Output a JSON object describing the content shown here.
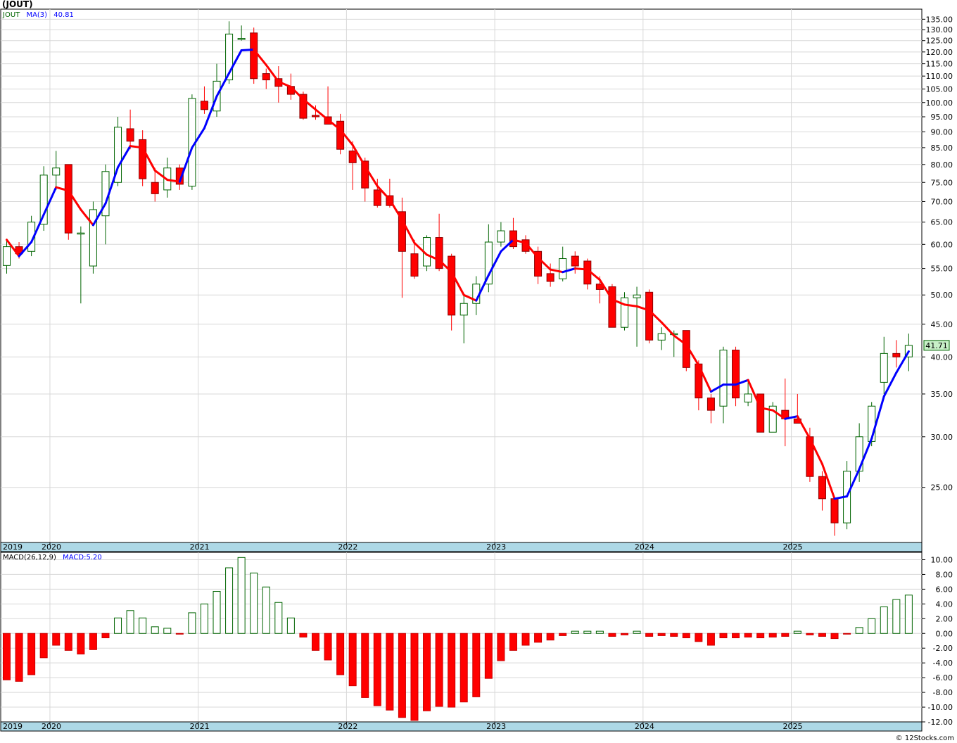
{
  "title": "(JOUT)",
  "legend": {
    "ticker": "JOUT",
    "ma_label": "MA(3)",
    "ma_value": "40.81",
    "macd_label": "MACD(26,12,9)",
    "macd_value": "MACD:5.20"
  },
  "last_price_label": "41.71",
  "credit": "© 12Stocks.com",
  "colors": {
    "up": "#006400",
    "down": "#ff0000",
    "ma_up": "#0000ff",
    "ma_down": "#ff0000",
    "axis_band": "#add8e6",
    "price_tag": "#c8f0c8"
  },
  "chart_data": [
    {
      "type": "candlestick",
      "scale": "log",
      "period": "monthly",
      "ylim": [
        20.5,
        140
      ],
      "y_ticks": [
        25,
        30,
        35,
        40,
        45,
        50,
        55,
        60,
        65,
        70,
        75,
        80,
        85,
        90,
        95,
        100,
        105,
        110,
        115,
        120,
        125,
        130,
        135
      ],
      "year_labels": [
        "2019",
        "2020",
        "2021",
        "2022",
        "2023",
        "2024",
        "2025"
      ],
      "ohlc": [
        [
          55.6,
          61.0,
          54.0,
          59.5
        ],
        [
          59.5,
          60.5,
          57.0,
          58.0
        ],
        [
          58.5,
          66.5,
          57.5,
          65.0
        ],
        [
          64.5,
          79.5,
          63.0,
          77.0
        ],
        [
          77.0,
          84.0,
          73.0,
          79.0
        ],
        [
          80.0,
          80.0,
          61.0,
          62.5
        ],
        [
          62.5,
          64.0,
          48.5,
          62.5
        ],
        [
          55.5,
          70.0,
          54.0,
          68.0
        ],
        [
          66.5,
          80.0,
          60.0,
          78.0
        ],
        [
          75.0,
          95.0,
          74.0,
          91.5
        ],
        [
          91.0,
          97.5,
          84.5,
          87.0
        ],
        [
          87.5,
          90.5,
          74.0,
          76.0
        ],
        [
          75.0,
          79.0,
          70.0,
          72.0
        ],
        [
          73.0,
          82.0,
          71.0,
          79.0
        ],
        [
          79.0,
          80.0,
          73.0,
          74.5
        ],
        [
          74.0,
          103.0,
          73.0,
          101.5
        ],
        [
          100.5,
          106.0,
          96.0,
          97.5
        ],
        [
          97.0,
          115.0,
          95.0,
          108.0
        ],
        [
          108.5,
          134.0,
          107.0,
          128.0
        ],
        [
          126.0,
          132.0,
          125.0,
          126.0
        ],
        [
          128.5,
          131.0,
          107.0,
          109.0
        ],
        [
          111.0,
          113.0,
          105.0,
          108.5
        ],
        [
          109.0,
          114.0,
          100.0,
          106.0
        ],
        [
          106.0,
          111.0,
          101.0,
          103.0
        ],
        [
          103.0,
          104.0,
          94.0,
          94.5
        ],
        [
          95.5,
          99.0,
          94.0,
          95.0
        ],
        [
          95.0,
          106.0,
          92.5,
          92.5
        ],
        [
          93.5,
          96.0,
          83.0,
          84.5
        ],
        [
          84.0,
          87.0,
          73.0,
          80.5
        ],
        [
          81.0,
          82.0,
          70.0,
          73.5
        ],
        [
          73.0,
          76.0,
          68.5,
          69.0
        ],
        [
          71.5,
          76.0,
          68.5,
          69.0
        ],
        [
          67.5,
          71.0,
          49.5,
          58.5
        ],
        [
          58.0,
          61.0,
          53.0,
          53.5
        ],
        [
          55.5,
          62.0,
          54.5,
          61.5
        ],
        [
          61.5,
          67.0,
          54.5,
          55.0
        ],
        [
          57.5,
          58.0,
          44.0,
          46.5
        ],
        [
          46.5,
          50.0,
          42.0,
          48.5
        ],
        [
          48.5,
          53.5,
          46.5,
          52.0
        ],
        [
          52.0,
          64.5,
          50.5,
          60.5
        ],
        [
          60.5,
          65.0,
          59.5,
          63.0
        ],
        [
          63.0,
          66.0,
          59.0,
          59.5
        ],
        [
          61.0,
          62.0,
          58.0,
          58.5
        ],
        [
          58.5,
          59.5,
          52.0,
          53.5
        ],
        [
          54.0,
          56.0,
          51.5,
          52.5
        ],
        [
          53.0,
          59.5,
          52.5,
          57.0
        ],
        [
          57.5,
          58.5,
          54.0,
          55.5
        ],
        [
          56.5,
          57.0,
          51.0,
          52.0
        ],
        [
          52.0,
          53.5,
          48.5,
          51.0
        ],
        [
          51.5,
          52.0,
          44.5,
          44.5
        ],
        [
          44.5,
          50.5,
          44.0,
          49.5
        ],
        [
          49.5,
          51.5,
          41.5,
          50.0
        ],
        [
          50.5,
          51.0,
          42.0,
          42.5
        ],
        [
          42.5,
          44.5,
          41.0,
          43.5
        ],
        [
          43.5,
          44.0,
          40.0,
          43.5
        ],
        [
          44.0,
          44.0,
          38.0,
          38.5
        ],
        [
          39.0,
          39.5,
          33.0,
          34.5
        ],
        [
          34.5,
          35.0,
          31.5,
          33.0
        ],
        [
          33.5,
          41.5,
          31.5,
          41.0
        ],
        [
          41.0,
          41.5,
          33.5,
          34.5
        ],
        [
          34.0,
          36.5,
          33.5,
          35.0
        ],
        [
          35.0,
          35.0,
          30.5,
          30.5
        ],
        [
          30.5,
          34.0,
          30.5,
          33.5
        ],
        [
          33.0,
          37.0,
          29.0,
          32.0
        ],
        [
          32.0,
          35.0,
          31.5,
          31.5
        ],
        [
          30.0,
          31.0,
          25.5,
          26.0
        ],
        [
          26.0,
          26.5,
          23.0,
          24.0
        ],
        [
          24.0,
          24.0,
          21.0,
          22.0
        ],
        [
          22.0,
          27.5,
          21.5,
          26.5
        ],
        [
          26.5,
          31.5,
          25.5,
          30.0
        ],
        [
          29.5,
          34.0,
          29.0,
          33.5
        ],
        [
          36.5,
          43.0,
          35.0,
          40.5
        ],
        [
          40.5,
          42.5,
          38.5,
          40.0
        ],
        [
          40.0,
          43.5,
          38.0,
          41.7
        ]
      ],
      "ma3": [
        61.0,
        57.5,
        60.5,
        66.8,
        73.7,
        72.8,
        68.0,
        64.3,
        69.5,
        79.2,
        85.5,
        85.0,
        78.3,
        75.7,
        75.2,
        85.0,
        91.2,
        102.3,
        111.2,
        120.7,
        121.0,
        114.5,
        107.8,
        105.8,
        101.2,
        97.5,
        94.0,
        90.7,
        85.8,
        79.5,
        74.0,
        70.5,
        65.5,
        60.3,
        57.8,
        56.7,
        54.3,
        50.0,
        49.0,
        53.7,
        58.5,
        61.0,
        60.3,
        57.2,
        54.8,
        54.3,
        55.0,
        54.8,
        52.8,
        49.2,
        48.3,
        48.0,
        47.3,
        45.3,
        43.2,
        41.8,
        38.8,
        35.3,
        36.2,
        36.2,
        36.8,
        33.3,
        33.0,
        32.0,
        32.3,
        29.8,
        27.2,
        24.0,
        24.2,
        26.7,
        29.8,
        34.7,
        37.8,
        40.8
      ],
      "macd_hist": [
        -6.3,
        -6.5,
        -5.6,
        -3.3,
        -1.6,
        -2.3,
        -2.8,
        -2.2,
        -0.6,
        2.1,
        3.1,
        2.1,
        0.9,
        0.7,
        -0.1,
        2.8,
        4.0,
        5.7,
        8.9,
        10.3,
        8.2,
        6.3,
        4.2,
        2.1,
        -0.5,
        -2.3,
        -3.6,
        -5.6,
        -7.1,
        -8.7,
        -9.8,
        -10.4,
        -11.4,
        -11.8,
        -10.5,
        -9.9,
        -10.0,
        -9.3,
        -8.6,
        -6.1,
        -3.7,
        -2.3,
        -1.6,
        -1.2,
        -0.9,
        -0.3,
        0.3,
        0.3,
        0.3,
        -0.4,
        -0.2,
        0.3,
        -0.4,
        -0.3,
        -0.4,
        -0.6,
        -1.1,
        -1.6,
        -0.6,
        -0.6,
        -0.5,
        -0.6,
        -0.5,
        -0.4,
        0.3,
        -0.2,
        -0.4,
        -0.7,
        -0.1,
        0.8,
        2.0,
        3.6,
        4.6,
        5.2
      ],
      "macd_ylim": [
        -12,
        11
      ],
      "macd_ticks": [
        -12,
        -10,
        -8,
        -6,
        -4,
        -2,
        0,
        2,
        4,
        6,
        8,
        10
      ]
    }
  ]
}
